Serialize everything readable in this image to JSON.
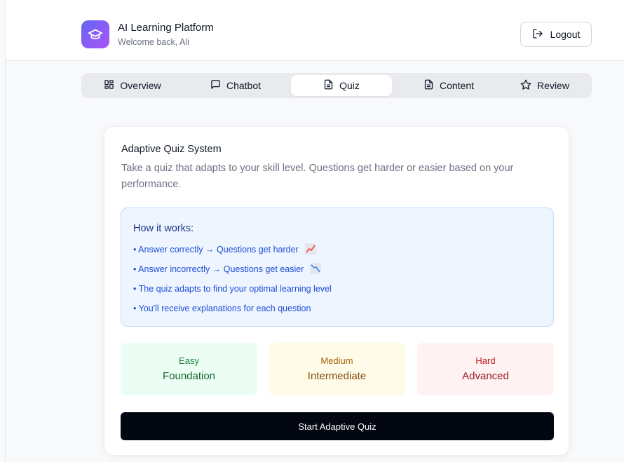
{
  "header": {
    "app_title": "AI Learning Platform",
    "subtitle": "Welcome back, Ali",
    "logout_label": "Logout",
    "logo_icon": "graduation-cap-icon"
  },
  "tabs": [
    {
      "label": "Overview",
      "icon": "grid-icon",
      "active": false
    },
    {
      "label": "Chatbot",
      "icon": "chat-bubble-icon",
      "active": false
    },
    {
      "label": "Quiz",
      "icon": "document-icon",
      "active": true
    },
    {
      "label": "Content",
      "icon": "document-icon",
      "active": false
    },
    {
      "label": "Review",
      "icon": "star-icon",
      "active": false
    }
  ],
  "quiz_card": {
    "title": "Adaptive Quiz System",
    "description": "Take a quiz that adapts to your skill level. Questions get harder or easier based on your performance.",
    "how_it_works": {
      "title": "How it works:",
      "items": [
        "• Answer correctly → Questions get harder",
        "• Answer incorrectly → Questions get easier",
        "• The quiz adapts to find your optimal learning level",
        "• You'll receive explanations for each question"
      ]
    },
    "levels": [
      {
        "difficulty": "Easy",
        "name": "Foundation",
        "bg": "#ecfdf3",
        "color": "#15803d"
      },
      {
        "difficulty": "Medium",
        "name": "Intermediate",
        "bg": "#fefce8",
        "color": "#a16207"
      },
      {
        "difficulty": "Hard",
        "name": "Advanced",
        "bg": "#fef2f2",
        "color": "#b91c1c"
      }
    ],
    "start_button_label": "Start Adaptive Quiz"
  },
  "colors": {
    "accent": "#6366f1",
    "primary_button": "#030712",
    "info_bg": "#eef5ff",
    "info_border": "#bfdbfe"
  }
}
